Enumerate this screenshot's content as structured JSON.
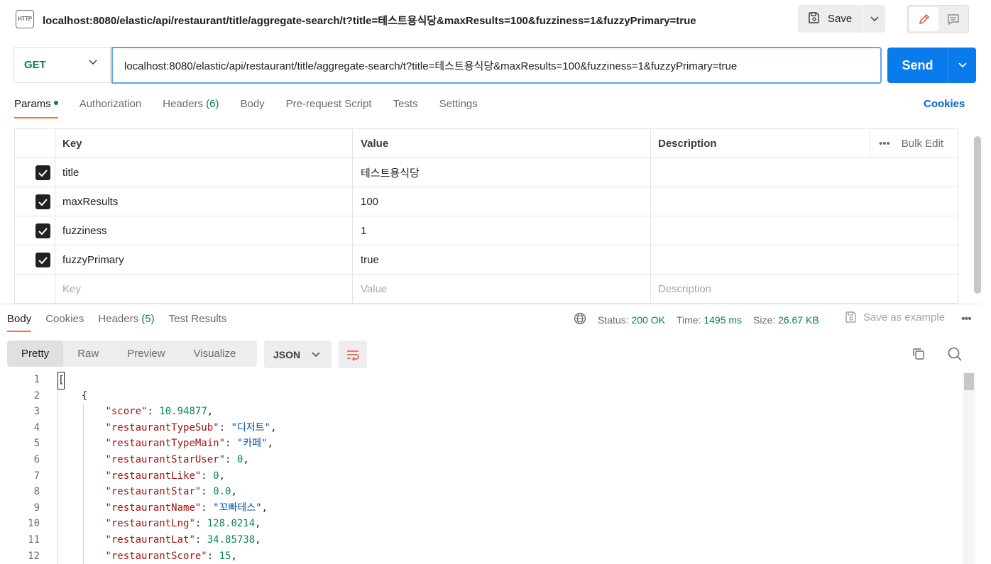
{
  "header": {
    "icon_text": "HTTP",
    "title": "localhost:8080/elastic/api/restaurant/title/aggregate-search/t?title=테스트용식당&maxResults=100&fuzziness=1&fuzzyPrimary=true",
    "save_label": "Save"
  },
  "request": {
    "method": "GET",
    "url": "localhost:8080/elastic/api/restaurant/title/aggregate-search/t?title=테스트용식당&maxResults=100&fuzziness=1&fuzzyPrimary=true",
    "send_label": "Send"
  },
  "request_tabs": {
    "params": "Params",
    "authorization": "Authorization",
    "headers": "Headers",
    "headers_count": "(6)",
    "body": "Body",
    "prerequest": "Pre-request Script",
    "tests": "Tests",
    "settings": "Settings",
    "cookies": "Cookies"
  },
  "params_table": {
    "headers": {
      "key": "Key",
      "value": "Value",
      "description": "Description",
      "bulk_edit": "Bulk Edit"
    },
    "rows": [
      {
        "key": "title",
        "value": "테스트용식당",
        "checked": true
      },
      {
        "key": "maxResults",
        "value": "100",
        "checked": true
      },
      {
        "key": "fuzziness",
        "value": "1",
        "checked": true
      },
      {
        "key": "fuzzyPrimary",
        "value": "true",
        "checked": true
      }
    ],
    "placeholder": {
      "key": "Key",
      "value": "Value",
      "description": "Description"
    }
  },
  "response_tabs": {
    "body": "Body",
    "cookies": "Cookies",
    "headers": "Headers",
    "headers_count": "(5)",
    "test_results": "Test Results"
  },
  "response_meta": {
    "status_label": "Status:",
    "status_value": "200 OK",
    "time_label": "Time:",
    "time_value": "1495 ms",
    "size_label": "Size:",
    "size_value": "26.67 KB",
    "save_example": "Save as example"
  },
  "view_tabs": {
    "pretty": "Pretty",
    "raw": "Raw",
    "preview": "Preview",
    "visualize": "Visualize",
    "format": "JSON"
  },
  "code": {
    "line_numbers": [
      "1",
      "2",
      "3",
      "4",
      "5",
      "6",
      "7",
      "8",
      "9",
      "10",
      "11",
      "12"
    ],
    "l1": "[",
    "l2": "{",
    "l3_key": "\"score\"",
    "l3_val": "10.94877",
    "l4_key": "\"restaurantTypeSub\"",
    "l4_val": "\"디저트\"",
    "l5_key": "\"restaurantTypeMain\"",
    "l5_val": "\"카페\"",
    "l6_key": "\"restaurantStarUser\"",
    "l6_val": "0",
    "l7_key": "\"restaurantLike\"",
    "l7_val": "0",
    "l8_key": "\"restaurantStar\"",
    "l8_val": "0.0",
    "l9_key": "\"restaurantName\"",
    "l9_val": "\"꼬빠테스\"",
    "l10_key": "\"restaurantLng\"",
    "l10_val": "128.0214",
    "l11_key": "\"restaurantLat\"",
    "l11_val": "34.85738",
    "l12_key": "\"restaurantScore\"",
    "l12_val": "15"
  },
  "colors": {
    "accent": "#ff6c37",
    "send": "#097bed",
    "success": "#0b8043",
    "link": "#0265d2"
  }
}
